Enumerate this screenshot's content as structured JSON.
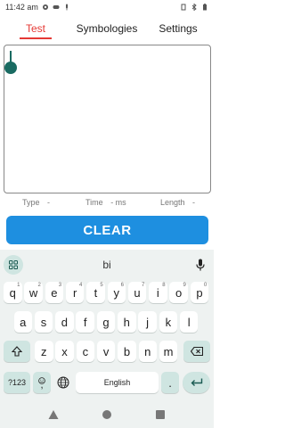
{
  "status": {
    "time": "11:42 am",
    "left_icons": [
      "settings-icon",
      "gamepad-icon",
      "mic-small-icon"
    ],
    "right_icons": [
      "vibrate-icon",
      "bluetooth-icon",
      "battery-icon"
    ]
  },
  "tabs": [
    {
      "label": "Test",
      "active": true
    },
    {
      "label": "Symbologies",
      "active": false
    },
    {
      "label": "Settings",
      "active": false
    }
  ],
  "output": {
    "text": ""
  },
  "info": {
    "type_label": "Type",
    "type_value": "-",
    "time_label": "Time",
    "time_value": "- ms",
    "length_label": "Length",
    "length_value": "-"
  },
  "clear_button": {
    "label": "CLEAR"
  },
  "keyboard": {
    "suggestion": "bi",
    "row1": [
      {
        "k": "q",
        "h": "1"
      },
      {
        "k": "w",
        "h": "2"
      },
      {
        "k": "e",
        "h": "3"
      },
      {
        "k": "r",
        "h": "4"
      },
      {
        "k": "t",
        "h": "5"
      },
      {
        "k": "y",
        "h": "6"
      },
      {
        "k": "u",
        "h": "7"
      },
      {
        "k": "i",
        "h": "8"
      },
      {
        "k": "o",
        "h": "9"
      },
      {
        "k": "p",
        "h": "0"
      }
    ],
    "row2": [
      "a",
      "s",
      "d",
      "f",
      "g",
      "h",
      "j",
      "k",
      "l"
    ],
    "row3": [
      "z",
      "x",
      "c",
      "v",
      "b",
      "n",
      "m"
    ],
    "symbols_label": "?123",
    "comma_label": ",",
    "space_label": "English",
    "period_label": ".",
    "accent_color": "#1e8fe0",
    "tab_active_color": "#e53935"
  }
}
